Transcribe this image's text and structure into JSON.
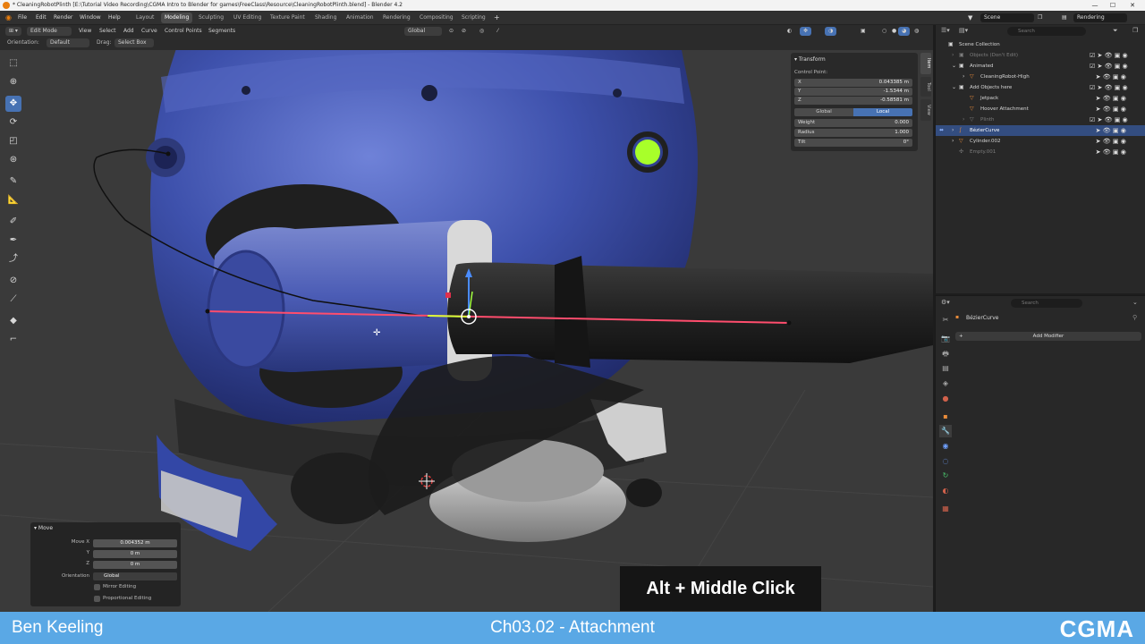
{
  "title_bar": {
    "text": "* CleaningRobotPlinth [E:\\Tutorial Video Recording\\CGMA Intro to Blender for games\\FreeClass\\Resource\\CleaningRobotPlinth.blend] - Blender 4.2"
  },
  "menu": {
    "file": "File",
    "edit": "Edit",
    "render": "Render",
    "window": "Window",
    "help": "Help"
  },
  "workspaces": [
    "Layout",
    "Modeling",
    "Sculpting",
    "UV Editing",
    "Texture Paint",
    "Shading",
    "Animation",
    "Rendering",
    "Compositing",
    "Scripting"
  ],
  "active_workspace": "Modeling",
  "scene": {
    "label": "Scene",
    "view_layer": "Rendering"
  },
  "viewport_header": {
    "mode": "Edit Mode",
    "menus": [
      "View",
      "Select",
      "Add",
      "Curve",
      "Control Points",
      "Segments"
    ],
    "orientation_label": "Orientation:",
    "orientation_value": "Default",
    "drag_label": "Drag:",
    "drag_value": "Select Box",
    "transform_orientation": "Global"
  },
  "n_panel": {
    "section": "Transform",
    "subtitle": "Control Point:",
    "x_label": "X",
    "x_value": "0.043385 m",
    "y_label": "Y",
    "y_value": "-1.5344 m",
    "z_label": "Z",
    "z_value": "-0.58581 m",
    "global_label": "Global",
    "local_label": "Local",
    "weight_label": "Weight",
    "weight_value": "0.000",
    "radius_label": "Radius",
    "radius_value": "1.000",
    "tilt_label": "Tilt",
    "tilt_value": "0°",
    "tabs": [
      "Item",
      "Tool",
      "View"
    ]
  },
  "outliner": {
    "search_placeholder": "Search",
    "root": "Scene Collection",
    "rows": [
      {
        "label": "Objects (Don't Edit)",
        "dim": true
      },
      {
        "label": "Animated",
        "dim": false
      },
      {
        "label": "CleaningRobot-High",
        "dim": false
      },
      {
        "label": "Add Objects here",
        "dim": false
      },
      {
        "label": "Jetpack",
        "dim": false
      },
      {
        "label": "Hoover Attachment",
        "dim": false
      },
      {
        "label": "Plinth",
        "dim": true
      },
      {
        "label": "BézierCurve",
        "dim": false
      },
      {
        "label": "Cylinder.002",
        "dim": false
      },
      {
        "label": "Empty.001",
        "dim": true
      }
    ]
  },
  "properties": {
    "search_placeholder": "Search",
    "object_name": "BézierCurve",
    "add_modifier": "Add Modifier"
  },
  "move_panel": {
    "title": "Move",
    "move_x_label": "Move X",
    "move_x_value": "0.004352 m",
    "y_label": "Y",
    "y_value": "0 m",
    "z_label": "Z",
    "z_value": "0 m",
    "orientation_label": "Orientation",
    "orientation_value": "Global",
    "mirror_label": "Mirror Editing",
    "proportional_label": "Proportional Editing"
  },
  "key_hint": "Alt + Middle Click",
  "banner": {
    "name": "Ben Keeling",
    "chapter": "Ch03.02 - Attachment",
    "brand": "CGMA"
  },
  "colors": {
    "accent": "#4772b3",
    "banner": "#5aa8e5",
    "robot_blue": "#3b4ea8",
    "curve_red": "#ff4d6d"
  }
}
